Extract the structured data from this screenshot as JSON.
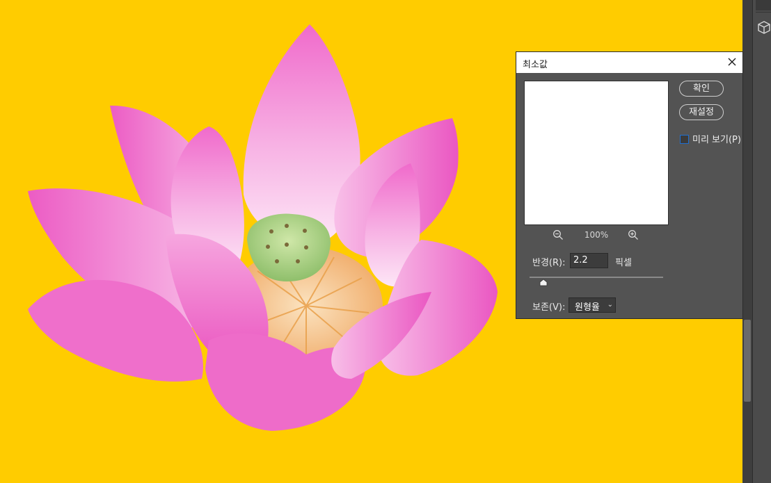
{
  "dialog": {
    "title": "최소값",
    "ok_label": "확인",
    "reset_label": "재설정",
    "preview_label": "미리 보기(P)",
    "preview_checked": false,
    "zoom_level": "100%",
    "radius_label": "반경(R):",
    "radius_value": "2.2",
    "radius_unit": "픽셀",
    "preserve_label": "보존(V):",
    "preserve_value": "원형율"
  },
  "colors": {
    "canvas_background": "#ffcc00",
    "dialog_background": "#535353",
    "checkbox_accent": "#1f6fd1"
  },
  "icons": [
    "close-icon",
    "zoom-out-icon",
    "zoom-in-icon",
    "chevron-down-icon",
    "3d-cube-icon"
  ]
}
